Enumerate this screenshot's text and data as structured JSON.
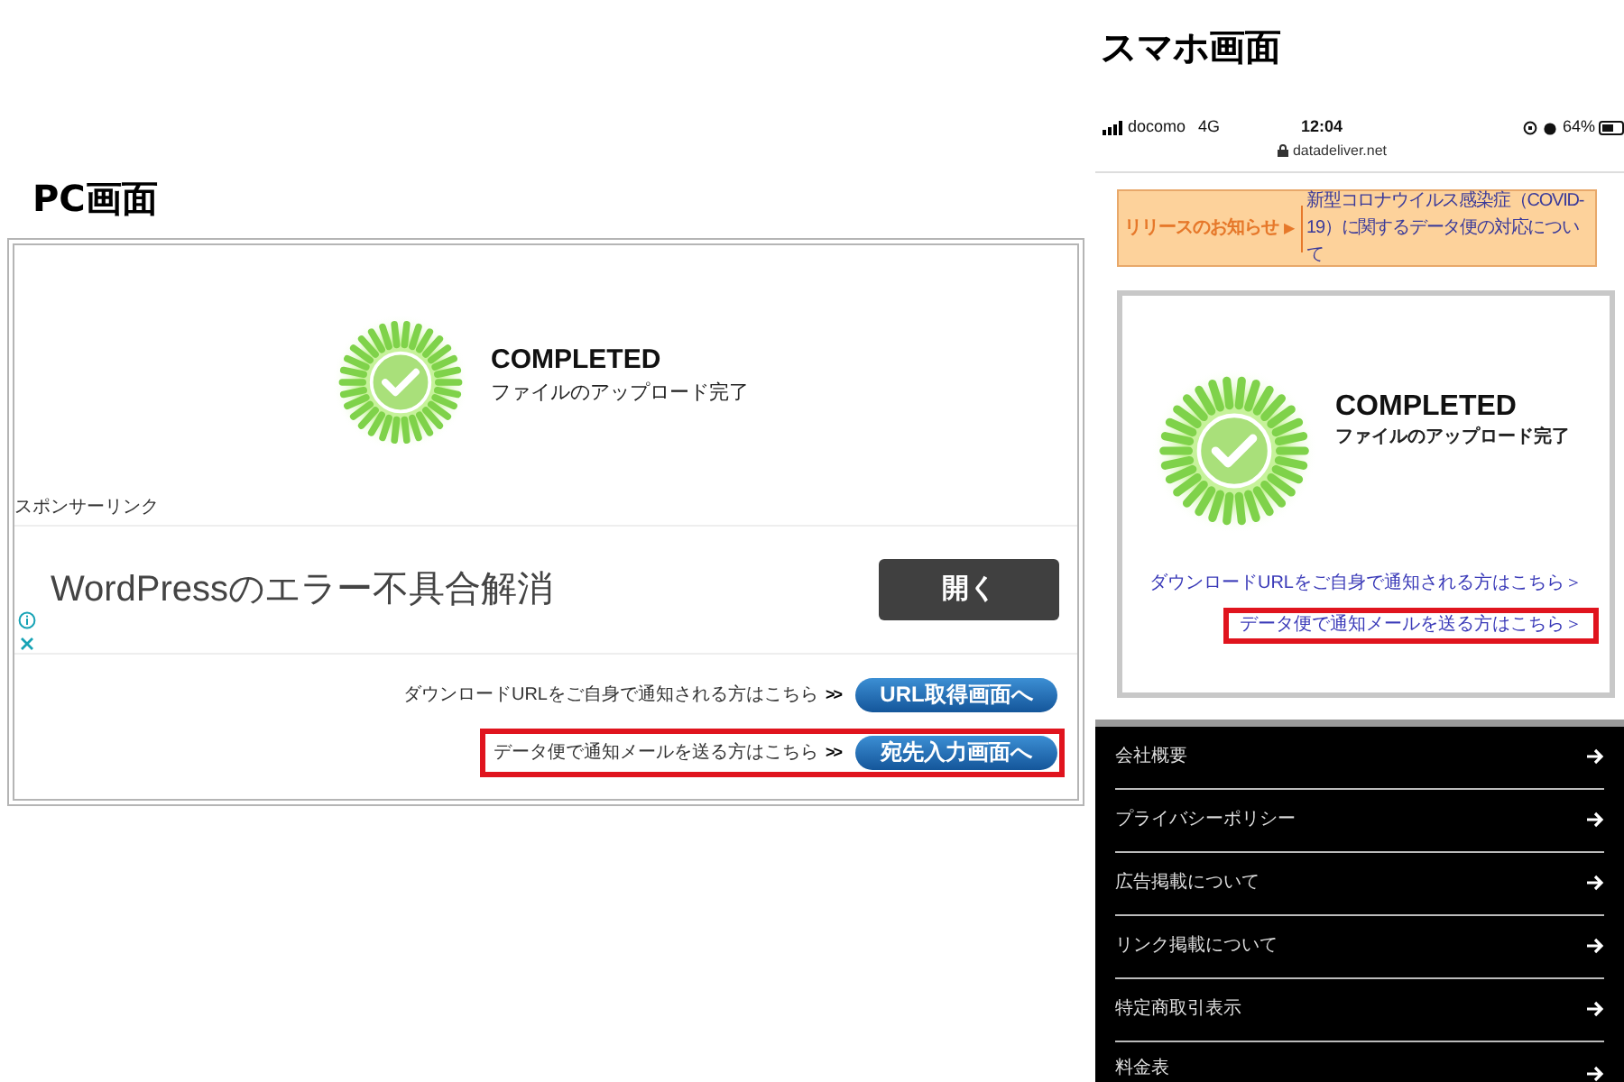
{
  "pc": {
    "heading": "PC画面",
    "status_title": "COMPLETED",
    "status_subtitle": "ファイルのアップロード完了",
    "sponsor_label": "スポンサーリンク",
    "ad": {
      "text": "WordPressのエラー不具合解消",
      "button": "開く"
    },
    "actions": [
      {
        "text": "ダウンロードURLをご自身で通知される方はこちら",
        "arrow": ">>",
        "button": "URL取得画面へ",
        "highlighted": false
      },
      {
        "text": "データ便で通知メールを送る方はこちら",
        "arrow": ">>",
        "button": "宛先入力画面へ",
        "highlighted": true
      }
    ]
  },
  "mobile": {
    "heading": "スマホ画面",
    "status_bar": {
      "carrier": "docomo",
      "network": "4G",
      "time": "12:04",
      "battery": "64%"
    },
    "url": "datadeliver.net",
    "notice": {
      "label": "リリースのお知らせ",
      "marker": "▶",
      "text": "新型コロナウイルス感染症（COVID-19）に関するデータ便の対応について"
    },
    "status_title": "COMPLETED",
    "status_subtitle": "ファイルのアップロード完了",
    "links": [
      {
        "text": "ダウンロードURLをご自身で通知される方はこちら＞",
        "highlighted": false
      },
      {
        "text": "データ便で通知メールを送る方はこちら＞",
        "highlighted": true
      }
    ],
    "menu": [
      "会社概要",
      "プライバシーポリシー",
      "広告掲載について",
      "リンク掲載について",
      "特定商取引表示",
      "料金表"
    ]
  }
}
